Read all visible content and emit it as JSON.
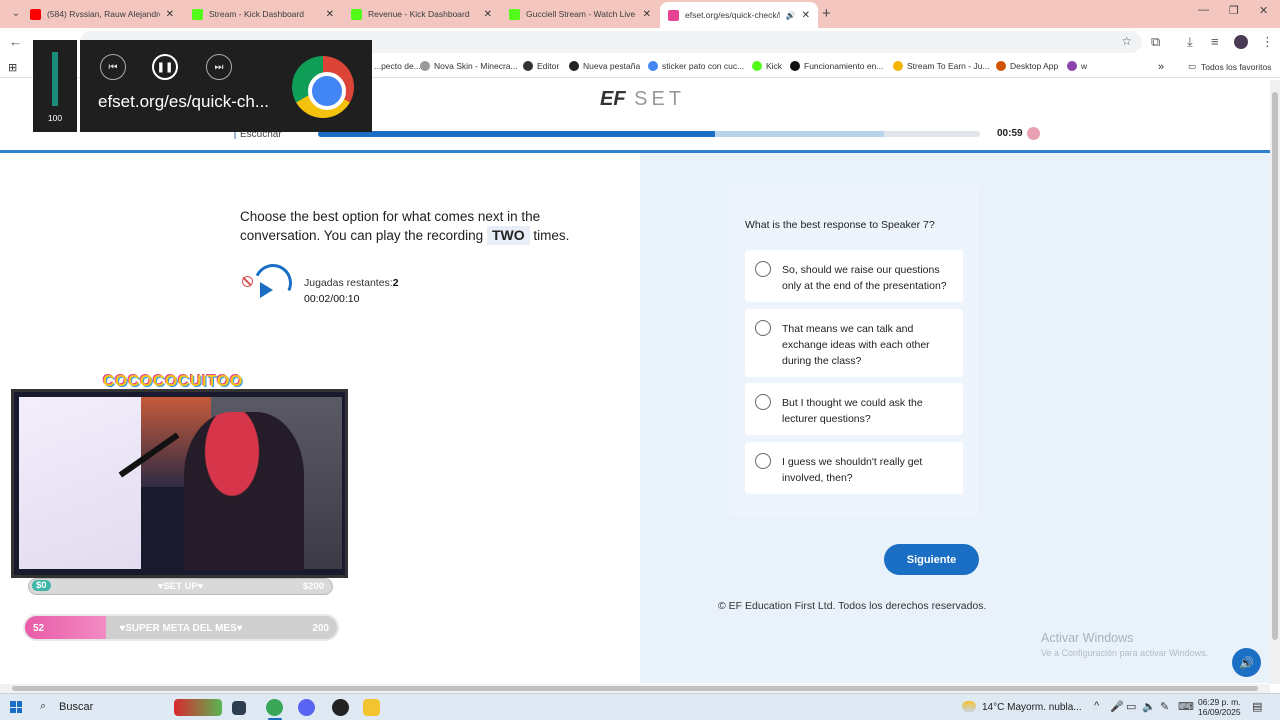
{
  "browser": {
    "tabs": [
      {
        "title": "(584) Rvssian, Rauw Alejandro, ...",
        "icon": "youtube-icon",
        "color": "#ff0000",
        "active": false
      },
      {
        "title": "Stream - Kick Dashboard",
        "icon": "kick-icon",
        "color": "#53fc18",
        "active": false
      },
      {
        "title": "Revenue - Kick Dashboard",
        "icon": "kick-icon",
        "color": "#53fc18",
        "active": false
      },
      {
        "title": "Gucciell Stream - Watch Live on ...",
        "icon": "kick-icon",
        "color": "#53fc18",
        "active": false
      },
      {
        "title": "efset.org/es/quick-check/la",
        "icon": "efset-icon",
        "color": "#e84393",
        "active": true
      }
    ],
    "new_tab": "+",
    "window_controls": {
      "minimize": "—",
      "restore": "❐",
      "close": "✕"
    },
    "bookmarks": [
      {
        "label": "...pecto de...",
        "color": "#888"
      },
      {
        "label": "Nova Skin - Minecra...",
        "color": "#9a9a9a"
      },
      {
        "label": "Editor",
        "color": "#333"
      },
      {
        "label": "Nueva pestaña",
        "color": "#222"
      },
      {
        "label": "sticker pato con cuc...",
        "color": "#4285f4"
      },
      {
        "label": "Kick",
        "color": "#53fc18"
      },
      {
        "label": "Funcionamiento en...",
        "color": "#111"
      },
      {
        "label": "Stream To Earn - Ju...",
        "color": "#f5b400"
      },
      {
        "label": "Desktop App",
        "color": "#d35400"
      },
      {
        "label": "w",
        "color": "#8e44ad"
      }
    ],
    "all_bookmarks": "Todos los favoritos"
  },
  "media_overlay": {
    "volume_value": "100",
    "volume_level": 1.0,
    "url": "efset.org/es/quick-ch..."
  },
  "page": {
    "logo_bold": "EF",
    "logo_light": "SET",
    "section": "Escuchar",
    "progress_fraction": 0.6,
    "buffer_fraction": 0.855,
    "timer": "00:59",
    "instructions_before": "Choose the best option for what comes next in the conversation. You can play the recording",
    "instructions_highlight": "TWO",
    "instructions_after": "times.",
    "plays_label": "Jugadas restantes:",
    "plays_value": "2",
    "play_time": "00:02/00:10",
    "question": "What is the best response to Speaker 7?",
    "options": [
      "So, should we raise our questions only at the end of the presentation?",
      "That means we can talk and exchange ideas with each other during the class?",
      "But I thought we could ask the lecturer questions?",
      "I guess we shouldn't really get involved, then?"
    ],
    "next_button": "Siguiente",
    "copyright": "© EF Education First Ltd. Todos los derechos reservados."
  },
  "windows_watermark": {
    "title": "Activar Windows",
    "subtitle": "Ve a Configuración para activar Windows."
  },
  "stream_overlay": {
    "title": "COCOCOCUITOO",
    "goal1": {
      "left": "$0",
      "center": "♥SET UP♥",
      "right": "$200",
      "fraction": 0.0
    },
    "goal2": {
      "left": "52",
      "center": "♥SUPER META DEL MES♥",
      "right": "200",
      "fraction": 0.26
    }
  },
  "taskbar": {
    "search": "Buscar",
    "weather": "14°C  Mayorm. nubla...",
    "time": "06:29 p. m.",
    "date": "16/09/2025"
  }
}
